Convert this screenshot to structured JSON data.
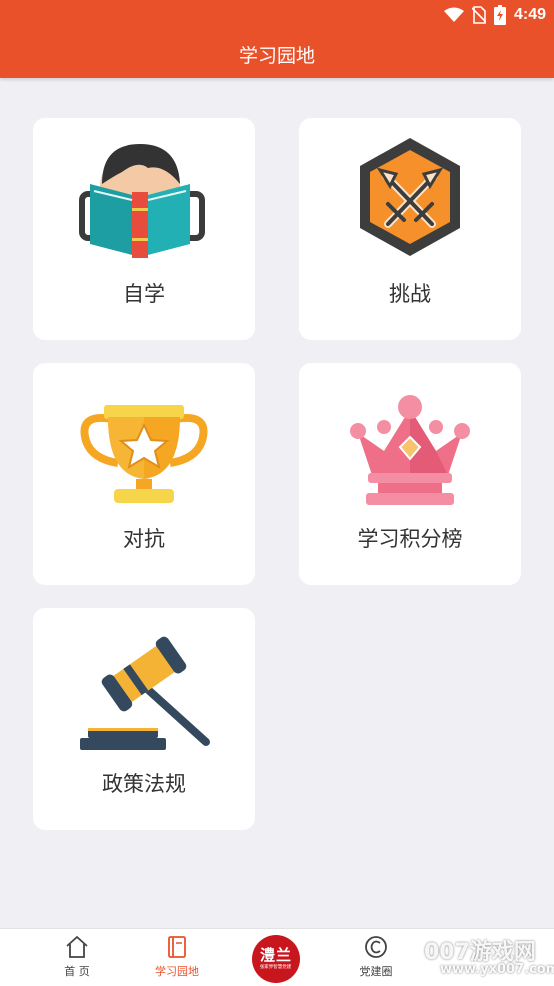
{
  "status_bar": {
    "time": "4:49",
    "icons": [
      "wifi-icon",
      "no-sim-icon",
      "battery-charging-icon"
    ]
  },
  "app_bar": {
    "title": "学习园地"
  },
  "cards": [
    {
      "label": "自学",
      "icon": "reading-book-icon"
    },
    {
      "label": "挑战",
      "icon": "crossed-swords-icon"
    },
    {
      "label": "对抗",
      "icon": "trophy-icon"
    },
    {
      "label": "学习积分榜",
      "icon": "crown-icon"
    },
    {
      "label": "政策法规",
      "icon": "gavel-icon"
    }
  ],
  "bottom_nav": {
    "items": [
      {
        "label": "首 页",
        "icon": "home-icon",
        "active": false
      },
      {
        "label": "学习园地",
        "icon": "book-icon",
        "active": true
      },
      {
        "label": "党建圈",
        "icon": "circle-c-icon",
        "active": false
      }
    ],
    "center_logo": {
      "title": "澧兰",
      "subtitle": "张家界智慧党建"
    },
    "active_color": "#e9512b"
  },
  "theme": {
    "primary": "#e9512b",
    "background": "#efeff4",
    "card": "#ffffff"
  },
  "watermark": {
    "main": "007游戏网",
    "sub": "www.yx007.com"
  }
}
